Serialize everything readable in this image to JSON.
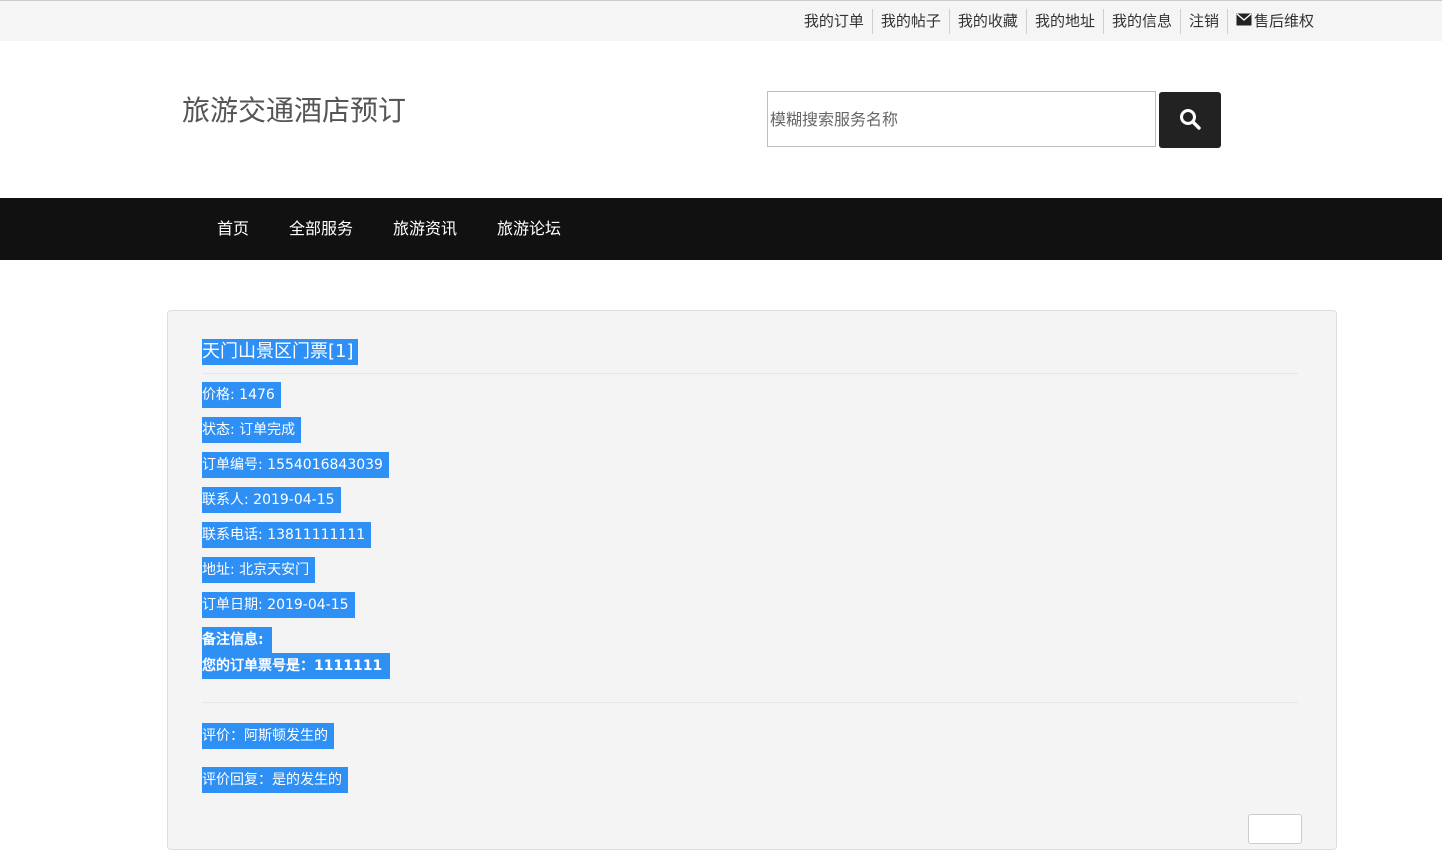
{
  "topbar": {
    "links": [
      {
        "label": "我的订单"
      },
      {
        "label": "我的帖子"
      },
      {
        "label": "我的收藏"
      },
      {
        "label": "我的地址"
      },
      {
        "label": "我的信息"
      },
      {
        "label": "注销"
      },
      {
        "label": "售后维权",
        "icon": "envelope-icon"
      }
    ]
  },
  "header": {
    "site_title": "旅游交通酒店预订",
    "search": {
      "placeholder": "模糊搜索服务名称",
      "value": "",
      "icon": "search-icon"
    }
  },
  "nav": {
    "items": [
      {
        "label": "首页"
      },
      {
        "label": "全部服务"
      },
      {
        "label": "旅游资讯"
      },
      {
        "label": "旅游论坛"
      }
    ]
  },
  "order": {
    "title": "天门山景区门票[1]",
    "price": "价格: 1476",
    "status": "状态: 订单完成",
    "order_no": "订单编号: 1554016843039",
    "contact": "联系人: 2019-04-15",
    "phone": "联系电话: 13811111111",
    "address": "地址: 北京天安门",
    "order_date": "订单日期: 2019-04-15",
    "remark_label": "备注信息:",
    "remark_text": "您的订单票号是：1111111",
    "review": "评价：阿斯顿发生的",
    "review_reply": "评价回复：是的发生的",
    "action_label": ""
  },
  "colors": {
    "nav_bg": "#111111",
    "selection": "#2e8ff5",
    "search_button": "#222222"
  }
}
